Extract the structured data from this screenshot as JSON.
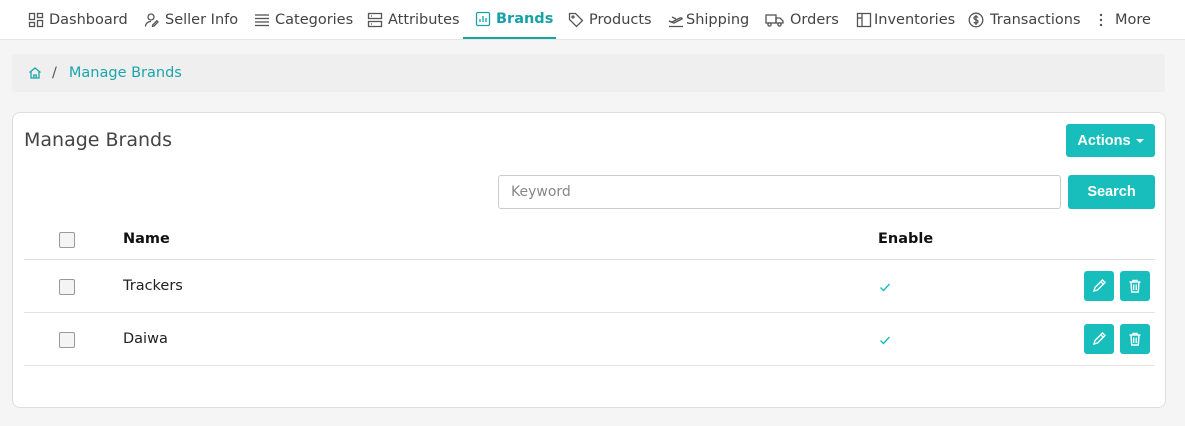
{
  "nav": {
    "items": [
      {
        "label": "Dashboard",
        "icon": "dashboard-grid-icon"
      },
      {
        "label": "Seller Info",
        "icon": "user-icon"
      },
      {
        "label": "Categories",
        "icon": "list-lines-icon"
      },
      {
        "label": "Attributes",
        "icon": "server-icon"
      },
      {
        "label": "Brands",
        "icon": "bar-chart-icon",
        "active": true
      },
      {
        "label": "Products",
        "icon": "tag-icon"
      },
      {
        "label": "Shipping",
        "icon": "plane-icon"
      },
      {
        "label": "Orders",
        "icon": "truck-icon"
      },
      {
        "label": "Inventories",
        "icon": "layout-icon"
      },
      {
        "label": "Transactions",
        "icon": "dollar-circle-icon"
      },
      {
        "label": "More",
        "icon": "more-vertical-icon"
      }
    ]
  },
  "breadcrumb": {
    "separator": "/",
    "current": "Manage Brands"
  },
  "card": {
    "title": "Manage Brands",
    "actions_label": "Actions",
    "search_placeholder": "Keyword",
    "search_value": "",
    "search_label": "Search"
  },
  "table": {
    "columns": [
      "Name",
      "Enable"
    ],
    "rows": [
      {
        "name": "Trackers",
        "enabled": true
      },
      {
        "name": "Daiwa",
        "enabled": true
      }
    ]
  },
  "colors": {
    "accent": "#17bebb",
    "active_nav": "#17a2a6"
  }
}
